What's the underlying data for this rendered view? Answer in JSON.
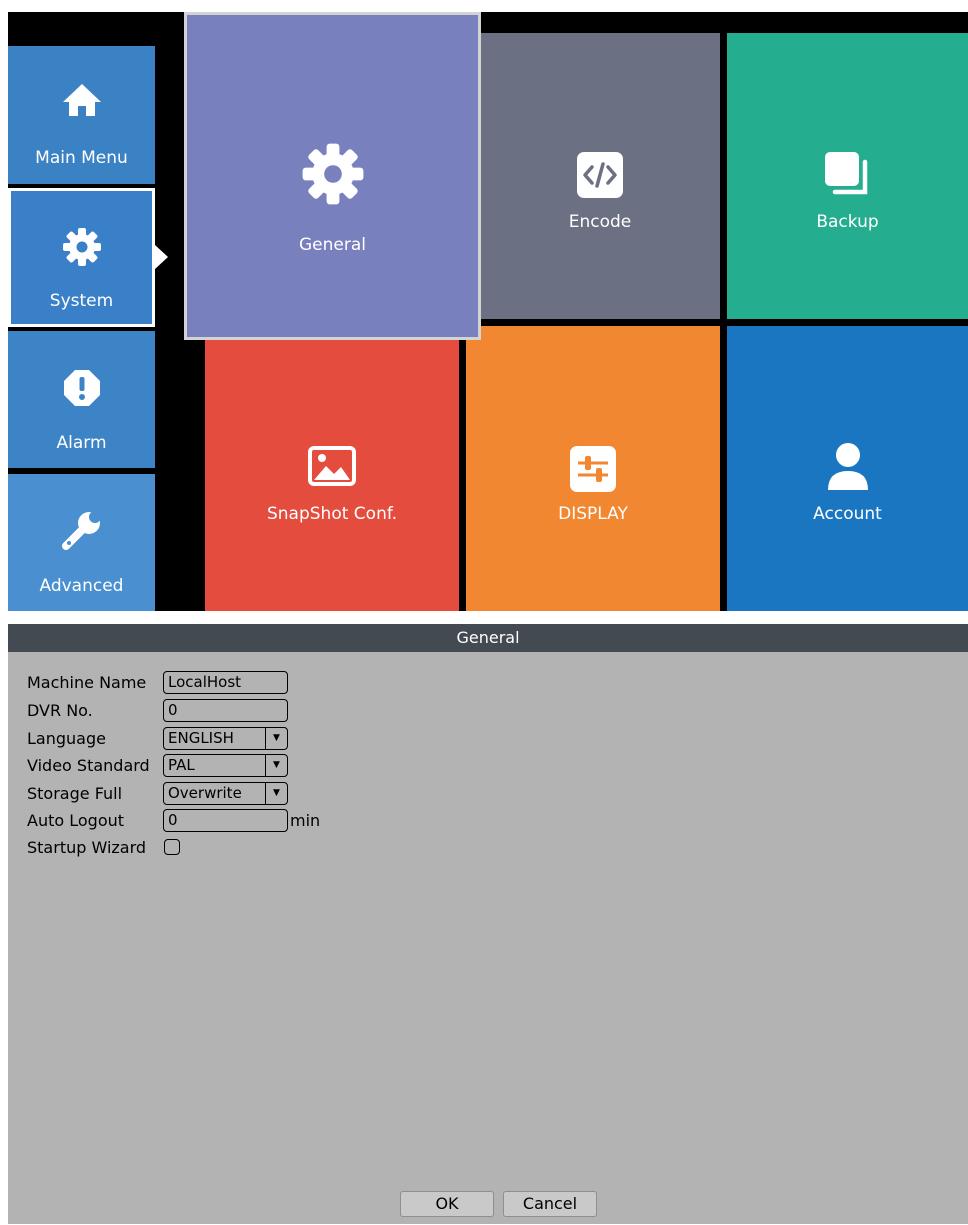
{
  "sidebar": {
    "items": [
      {
        "label": "Main Menu",
        "icon": "home-icon"
      },
      {
        "label": "System",
        "icon": "gear-icon"
      },
      {
        "label": "Alarm",
        "icon": "alert-icon"
      },
      {
        "label": "Advanced",
        "icon": "wrench-icon"
      }
    ],
    "selected": "System"
  },
  "tiles": [
    {
      "label": "General",
      "icon": "gear-icon",
      "color": "#7880be"
    },
    {
      "label": "Encode",
      "icon": "code-icon",
      "color": "#6b7083"
    },
    {
      "label": "Backup",
      "icon": "backup-icon",
      "color": "#24ad8f"
    },
    {
      "label": "SnapShot Conf.",
      "icon": "image-icon",
      "color": "#e44d3e"
    },
    {
      "label": "DISPLAY",
      "icon": "sliders-icon",
      "color": "#f28731"
    },
    {
      "label": "Account",
      "icon": "user-icon",
      "color": "#1b76c2"
    }
  ],
  "dialog": {
    "title": "General",
    "fields": {
      "machine_name": {
        "label": "Machine Name",
        "value": "LocalHost"
      },
      "dvr_no": {
        "label": "DVR No.",
        "value": "0"
      },
      "language": {
        "label": "Language",
        "value": "ENGLISH"
      },
      "video_standard": {
        "label": "Video Standard",
        "value": "PAL"
      },
      "storage_full": {
        "label": "Storage Full",
        "value": "Overwrite"
      },
      "auto_logout": {
        "label": "Auto Logout",
        "value": "0",
        "unit": "min"
      },
      "startup_wizard": {
        "label": "Startup Wizard",
        "checked": false
      }
    },
    "ok_label": "OK",
    "cancel_label": "Cancel"
  }
}
